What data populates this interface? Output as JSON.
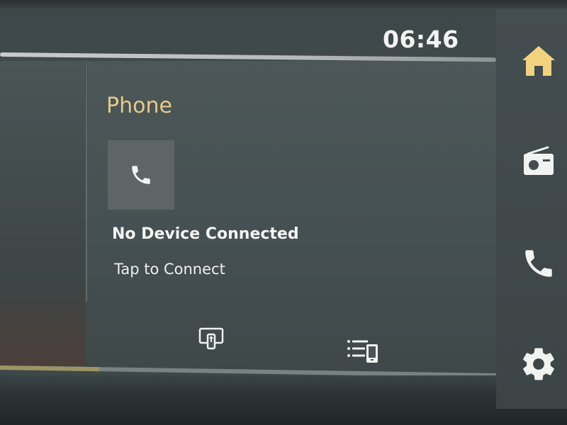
{
  "status_bar": {
    "clock": "06:46"
  },
  "phone": {
    "title": "Phone",
    "status": "No Device Connected",
    "action": "Tap to Connect"
  },
  "progress": {
    "fraction": 0.2
  },
  "nav": {
    "items": [
      {
        "name": "home",
        "icon": "home-icon"
      },
      {
        "name": "radio",
        "icon": "radio-icon"
      },
      {
        "name": "phone",
        "icon": "phone-icon"
      },
      {
        "name": "settings",
        "icon": "gear-icon"
      }
    ]
  },
  "colors": {
    "accent": "#e6c98a",
    "home_active": "#f2d27e",
    "text": "#f4f5f3"
  }
}
